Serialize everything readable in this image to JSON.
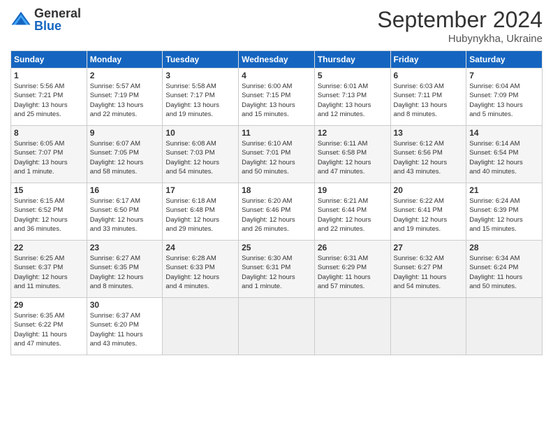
{
  "header": {
    "logo_general": "General",
    "logo_blue": "Blue",
    "month_title": "September 2024",
    "location": "Hubynykha, Ukraine"
  },
  "weekdays": [
    "Sunday",
    "Monday",
    "Tuesday",
    "Wednesday",
    "Thursday",
    "Friday",
    "Saturday"
  ],
  "weeks": [
    [
      {
        "day": "1",
        "info": "Sunrise: 5:56 AM\nSunset: 7:21 PM\nDaylight: 13 hours\nand 25 minutes."
      },
      {
        "day": "2",
        "info": "Sunrise: 5:57 AM\nSunset: 7:19 PM\nDaylight: 13 hours\nand 22 minutes."
      },
      {
        "day": "3",
        "info": "Sunrise: 5:58 AM\nSunset: 7:17 PM\nDaylight: 13 hours\nand 19 minutes."
      },
      {
        "day": "4",
        "info": "Sunrise: 6:00 AM\nSunset: 7:15 PM\nDaylight: 13 hours\nand 15 minutes."
      },
      {
        "day": "5",
        "info": "Sunrise: 6:01 AM\nSunset: 7:13 PM\nDaylight: 13 hours\nand 12 minutes."
      },
      {
        "day": "6",
        "info": "Sunrise: 6:03 AM\nSunset: 7:11 PM\nDaylight: 13 hours\nand 8 minutes."
      },
      {
        "day": "7",
        "info": "Sunrise: 6:04 AM\nSunset: 7:09 PM\nDaylight: 13 hours\nand 5 minutes."
      }
    ],
    [
      {
        "day": "8",
        "info": "Sunrise: 6:05 AM\nSunset: 7:07 PM\nDaylight: 13 hours\nand 1 minute."
      },
      {
        "day": "9",
        "info": "Sunrise: 6:07 AM\nSunset: 7:05 PM\nDaylight: 12 hours\nand 58 minutes."
      },
      {
        "day": "10",
        "info": "Sunrise: 6:08 AM\nSunset: 7:03 PM\nDaylight: 12 hours\nand 54 minutes."
      },
      {
        "day": "11",
        "info": "Sunrise: 6:10 AM\nSunset: 7:01 PM\nDaylight: 12 hours\nand 50 minutes."
      },
      {
        "day": "12",
        "info": "Sunrise: 6:11 AM\nSunset: 6:58 PM\nDaylight: 12 hours\nand 47 minutes."
      },
      {
        "day": "13",
        "info": "Sunrise: 6:12 AM\nSunset: 6:56 PM\nDaylight: 12 hours\nand 43 minutes."
      },
      {
        "day": "14",
        "info": "Sunrise: 6:14 AM\nSunset: 6:54 PM\nDaylight: 12 hours\nand 40 minutes."
      }
    ],
    [
      {
        "day": "15",
        "info": "Sunrise: 6:15 AM\nSunset: 6:52 PM\nDaylight: 12 hours\nand 36 minutes."
      },
      {
        "day": "16",
        "info": "Sunrise: 6:17 AM\nSunset: 6:50 PM\nDaylight: 12 hours\nand 33 minutes."
      },
      {
        "day": "17",
        "info": "Sunrise: 6:18 AM\nSunset: 6:48 PM\nDaylight: 12 hours\nand 29 minutes."
      },
      {
        "day": "18",
        "info": "Sunrise: 6:20 AM\nSunset: 6:46 PM\nDaylight: 12 hours\nand 26 minutes."
      },
      {
        "day": "19",
        "info": "Sunrise: 6:21 AM\nSunset: 6:44 PM\nDaylight: 12 hours\nand 22 minutes."
      },
      {
        "day": "20",
        "info": "Sunrise: 6:22 AM\nSunset: 6:41 PM\nDaylight: 12 hours\nand 19 minutes."
      },
      {
        "day": "21",
        "info": "Sunrise: 6:24 AM\nSunset: 6:39 PM\nDaylight: 12 hours\nand 15 minutes."
      }
    ],
    [
      {
        "day": "22",
        "info": "Sunrise: 6:25 AM\nSunset: 6:37 PM\nDaylight: 12 hours\nand 11 minutes."
      },
      {
        "day": "23",
        "info": "Sunrise: 6:27 AM\nSunset: 6:35 PM\nDaylight: 12 hours\nand 8 minutes."
      },
      {
        "day": "24",
        "info": "Sunrise: 6:28 AM\nSunset: 6:33 PM\nDaylight: 12 hours\nand 4 minutes."
      },
      {
        "day": "25",
        "info": "Sunrise: 6:30 AM\nSunset: 6:31 PM\nDaylight: 12 hours\nand 1 minute."
      },
      {
        "day": "26",
        "info": "Sunrise: 6:31 AM\nSunset: 6:29 PM\nDaylight: 11 hours\nand 57 minutes."
      },
      {
        "day": "27",
        "info": "Sunrise: 6:32 AM\nSunset: 6:27 PM\nDaylight: 11 hours\nand 54 minutes."
      },
      {
        "day": "28",
        "info": "Sunrise: 6:34 AM\nSunset: 6:24 PM\nDaylight: 11 hours\nand 50 minutes."
      }
    ],
    [
      {
        "day": "29",
        "info": "Sunrise: 6:35 AM\nSunset: 6:22 PM\nDaylight: 11 hours\nand 47 minutes."
      },
      {
        "day": "30",
        "info": "Sunrise: 6:37 AM\nSunset: 6:20 PM\nDaylight: 11 hours\nand 43 minutes."
      },
      {
        "day": "",
        "info": ""
      },
      {
        "day": "",
        "info": ""
      },
      {
        "day": "",
        "info": ""
      },
      {
        "day": "",
        "info": ""
      },
      {
        "day": "",
        "info": ""
      }
    ]
  ]
}
